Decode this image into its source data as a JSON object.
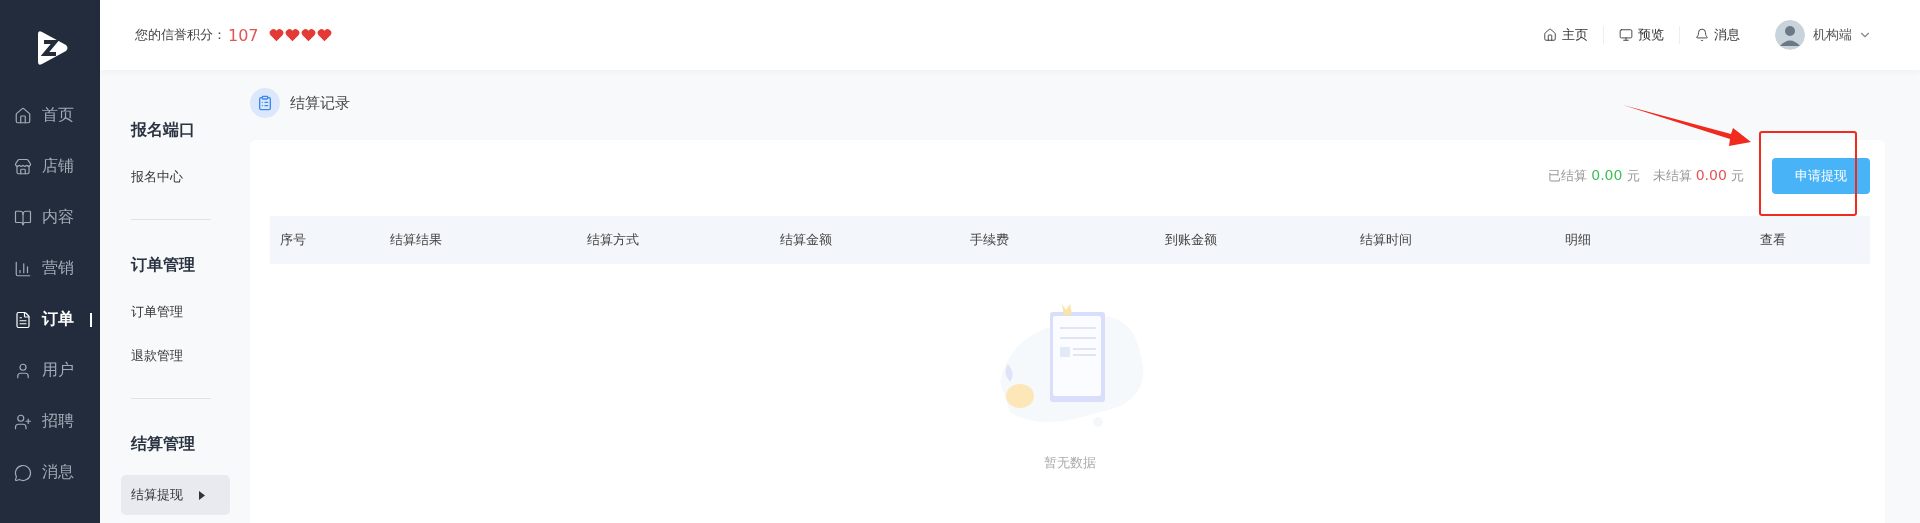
{
  "sidebar": {
    "items": [
      {
        "label": "首页",
        "selected": false
      },
      {
        "label": "店铺",
        "selected": false
      },
      {
        "label": "内容",
        "selected": false
      },
      {
        "label": "营销",
        "selected": false
      },
      {
        "label": "订单",
        "selected": true
      },
      {
        "label": "用户",
        "selected": false
      },
      {
        "label": "招聘",
        "selected": false
      },
      {
        "label": "消息",
        "selected": false
      }
    ]
  },
  "header": {
    "credit_label": "您的信誉积分：",
    "credit_score": "107",
    "stars": 4,
    "links": [
      {
        "label": "主页"
      },
      {
        "label": "预览"
      },
      {
        "label": "消息"
      }
    ],
    "account": "机构端"
  },
  "subnav": {
    "groups": [
      {
        "title": "报名端口",
        "items": [
          {
            "label": "报名中心",
            "selected": false
          }
        ]
      },
      {
        "title": "订单管理",
        "items": [
          {
            "label": "订单管理",
            "selected": false
          },
          {
            "label": "退款管理",
            "selected": false
          }
        ]
      },
      {
        "title": "结算管理",
        "items": [
          {
            "label": "结算提现",
            "selected": true
          }
        ]
      }
    ]
  },
  "page_title": "结算记录",
  "summary": {
    "settled_label": "已结算",
    "settled_value": "0.00",
    "settled_unit": "元",
    "unsettled_label": "未结算",
    "unsettled_value": "0.00",
    "unsettled_unit": "元"
  },
  "withdraw_button": "申请提现",
  "table": {
    "columns": [
      "序号",
      "结算结果",
      "结算方式",
      "结算金额",
      "手续费",
      "到账金额",
      "结算时间",
      "明细",
      "查看"
    ],
    "empty_text": "暂无数据"
  }
}
